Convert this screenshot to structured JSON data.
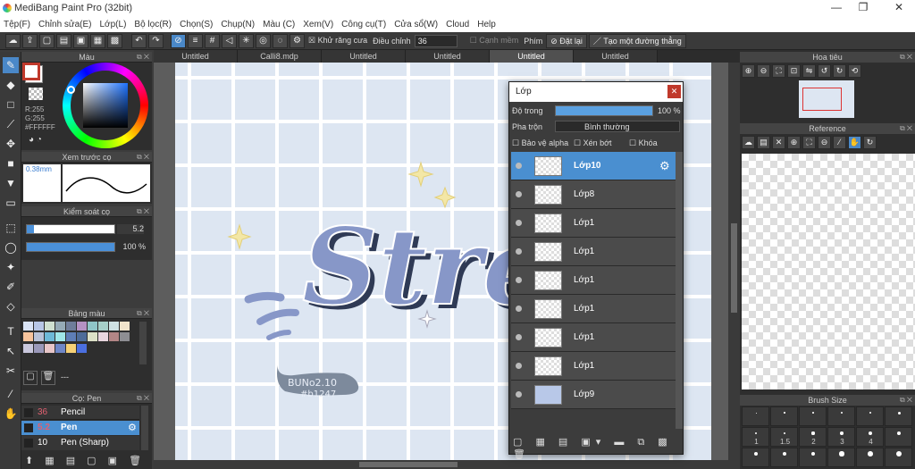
{
  "window": {
    "title": "MediBang Paint Pro (32bit)",
    "minimize": "—",
    "maximize": "❐",
    "close": "✕"
  },
  "menu": [
    "Tệp(F)",
    "Chỉnh sửa(E)",
    "Lớp(L)",
    "Bộ lọc(R)",
    "Chọn(S)",
    "Chụp(N)",
    "Màu (C)",
    "Xem(V)",
    "Công cụ(T)",
    "Cửa sổ(W)",
    "Cloud",
    "Help"
  ],
  "toolbar": {
    "antialias_label": "Khử răng cưa",
    "adjust_label": "Điều chỉnh",
    "adjust_value": "36",
    "edge_label": "Cạnh mềm",
    "pen_label": "Phím",
    "reset_label": "Đặt lại",
    "straight_label": "Tạo một đường thẳng"
  },
  "tabs": [
    "Untitled",
    "Calli8.mdp",
    "Untitled",
    "Untitled",
    "Untitled",
    "Untitled"
  ],
  "color_panel": {
    "title": "Màu",
    "r": "R:255",
    "g": "G:255",
    "hex": "#FFFFFF"
  },
  "brush_preview": {
    "title": "Xem trước cọ",
    "size": "0.38mm"
  },
  "brush_control": {
    "title": "Kiểm soát cọ",
    "size_value": "5.2",
    "opacity_value": "100 %",
    "opacity": 1.0
  },
  "palette": {
    "title": "Bảng màu",
    "dash": "---",
    "swatches": [
      "#d9e3f5",
      "#b7c6e6",
      "#cfe0d0",
      "#95aab6",
      "#6f7d9a",
      "#b592c4",
      "#8fc5c8",
      "#a6cfc9",
      "#cfe1e3",
      "#f1e4cb",
      "#f6c39c",
      "#b8c2d8",
      "#6db9d7",
      "#9fe7e9",
      "#5e7eb6",
      "#4e6c99",
      "#dde1c7",
      "#e8d6df",
      "#b38686",
      "#8e8e93",
      "#c9c7dc",
      "#9a98b9",
      "#e8c6c8",
      "#6f87c7",
      "#f5d076",
      "#4b6fe0"
    ]
  },
  "brush_list": {
    "title": "Cọ: Pen",
    "items": [
      {
        "size": "36",
        "name": "Pencil"
      },
      {
        "size": "5.2",
        "name": "Pen"
      },
      {
        "size": "10",
        "name": "Pen (Sharp)"
      }
    ]
  },
  "layers": {
    "title": "Lớp",
    "opacity_label": "Độ trong",
    "opacity_value": "100 %",
    "opacity": 1.0,
    "blend_label": "Pha trộn",
    "blend_value": "Bình thường",
    "protect_alpha": "Bảo vệ alpha",
    "clipping": "Xén bớt",
    "lock": "Khóa",
    "items": [
      "Lớp10",
      "Lớp8",
      "Lớp1",
      "Lớp1",
      "Lớp1",
      "Lớp1",
      "Lớp1",
      "Lớp1",
      "Lớp9"
    ]
  },
  "navigator": {
    "title": "Hoa tiêu"
  },
  "reference": {
    "title": "Reference"
  },
  "brush_size": {
    "title": "Brush Size",
    "values": [
      "1",
      "1.5",
      "2",
      "3",
      "4"
    ]
  },
  "art": {
    "word": "Stress",
    "stamp1": "BUNo2.10",
    "stamp2": "#b1247"
  }
}
